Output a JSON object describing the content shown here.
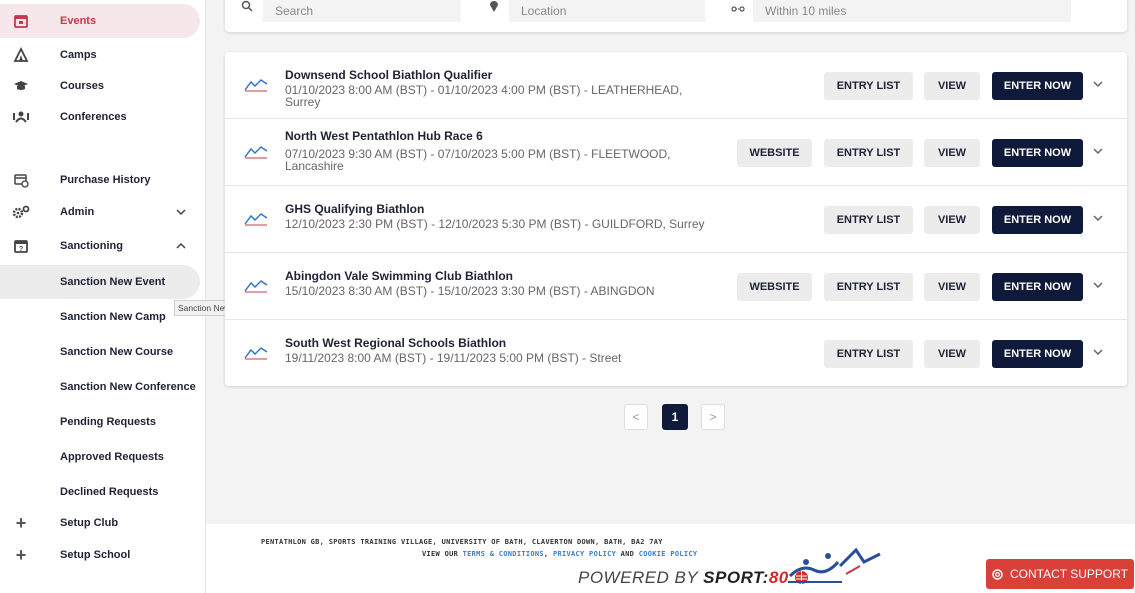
{
  "sidebar": {
    "items": [
      {
        "label": "Events",
        "icon": "calendar-icon"
      },
      {
        "label": "Camps",
        "icon": "tent-icon"
      },
      {
        "label": "Courses",
        "icon": "graduation-cap-icon"
      },
      {
        "label": "Conferences",
        "icon": "handshake-icon"
      },
      {
        "label": "Purchase History",
        "icon": "receipt-icon"
      },
      {
        "label": "Admin",
        "icon": "cogs-icon"
      },
      {
        "label": "Sanctioning",
        "icon": "calendar-question-icon"
      },
      {
        "label": "Sanction New Event"
      },
      {
        "label": "Sanction New Camp"
      },
      {
        "label": "Sanction New Course"
      },
      {
        "label": "Sanction New Conference"
      },
      {
        "label": "Pending Requests"
      },
      {
        "label": "Approved Requests"
      },
      {
        "label": "Declined Requests"
      },
      {
        "label": "Setup Club",
        "icon": "plus-icon"
      },
      {
        "label": "Setup School",
        "icon": "plus-icon"
      }
    ],
    "tooltip": "Sanction New Event"
  },
  "search": {
    "search_placeholder": "Search",
    "location_placeholder": "Location",
    "distance_value": "Within 10 miles"
  },
  "buttons": {
    "website": "WEBSITE",
    "entry_list": "ENTRY LIST",
    "view": "VIEW",
    "enter_now": "ENTER NOW"
  },
  "events": [
    {
      "title": "Downsend School Biathlon Qualifier",
      "details": "01/10/2023 8:00 AM (BST) - 01/10/2023 4:00 PM (BST) - LEATHERHEAD, Surrey",
      "has_website": false
    },
    {
      "title": "North West Pentathlon Hub Race 6",
      "details": "07/10/2023 9:30 AM (BST) - 07/10/2023 5:00 PM (BST) - FLEETWOOD, Lancashire",
      "has_website": true
    },
    {
      "title": "GHS Qualifying Biathlon",
      "details": "12/10/2023 2:30 PM (BST) - 12/10/2023 5:30 PM (BST) - GUILDFORD, Surrey",
      "has_website": false
    },
    {
      "title": "Abingdon Vale Swimming Club Biathlon",
      "details": "15/10/2023 8:30 AM (BST) - 15/10/2023 3:30 PM (BST) - ABINGDON",
      "has_website": true
    },
    {
      "title": "South West Regional Schools Biathlon",
      "details": "19/11/2023 8:00 AM (BST) - 19/11/2023 5:00 PM (BST) - Street",
      "has_website": false
    }
  ],
  "pagination": {
    "prev": "<",
    "current": "1",
    "next": ">"
  },
  "footer": {
    "address": "PENTATHLON GB, SPORTS TRAINING VILLAGE, UNIVERSITY OF BATH, CLAVERTON DOWN, BATH, BA2 7AY",
    "view_our": "VIEW OUR",
    "terms": "TERMS & CONDITIONS",
    "comma": ",",
    "privacy": "PRIVACY POLICY",
    "and": "AND",
    "cookie": "COOKIE POLICY",
    "powered_by": "POWERED BY",
    "sport": "SPORT:",
    "eighty": "80",
    "contact": "CONTACT SUPPORT"
  },
  "colors": {
    "accent": "#0f1a3a",
    "active_bg": "#f5e7ea",
    "support": "#d9403a",
    "link": "#3b7cc4"
  }
}
